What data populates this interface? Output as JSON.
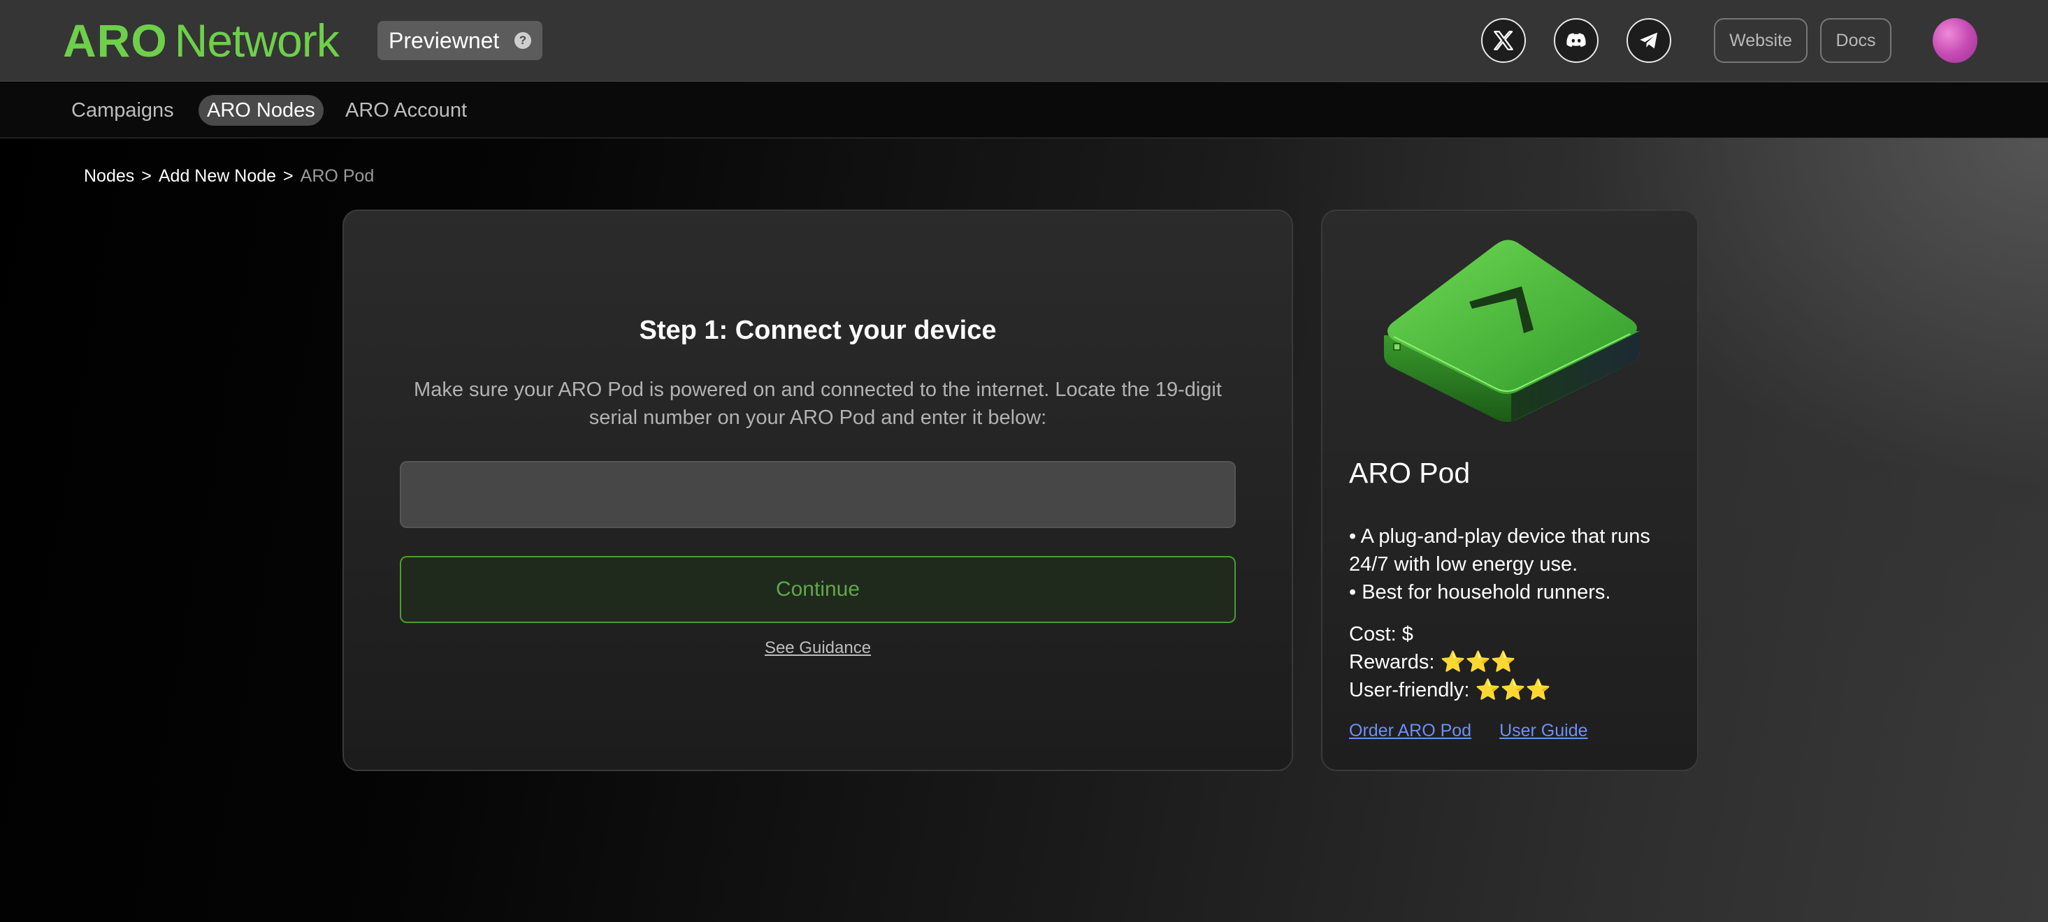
{
  "header": {
    "logo_bold": "ARO",
    "logo_thin": "Network",
    "network_badge": "Previewnet",
    "help_icon": "?",
    "social_icons": [
      "x-icon",
      "discord-icon",
      "telegram-icon"
    ],
    "website_label": "Website",
    "docs_label": "Docs"
  },
  "nav": {
    "items": [
      {
        "label": "Campaigns",
        "active": false
      },
      {
        "label": "ARO Nodes",
        "active": true
      },
      {
        "label": "ARO Account",
        "active": false
      }
    ]
  },
  "breadcrumb": {
    "items": [
      "Nodes",
      "Add New Node"
    ],
    "separator": ">",
    "current": "ARO Pod"
  },
  "main": {
    "title": "Step 1: Connect your device",
    "description": "Make sure your ARO Pod is powered on and connected to the internet. Locate the 19-digit serial number on your ARO Pod and enter it below:",
    "serial_value": "",
    "continue_label": "Continue",
    "guidance_link": "See Guidance"
  },
  "product": {
    "title": "ARO Pod",
    "features": [
      "• A plug-and-play device that runs 24/7 with low energy use.",
      "• Best for household runners."
    ],
    "cost": "Cost: $",
    "rewards": "Rewards: ⭐⭐⭐",
    "user_friendly": "User-friendly: ⭐⭐⭐",
    "order_link": "Order ARO Pod",
    "guide_link": "User Guide"
  },
  "colors": {
    "brand_green": "#6ed04a",
    "continue_border": "#4b9b36",
    "link_blue": "#6f8ff5"
  }
}
